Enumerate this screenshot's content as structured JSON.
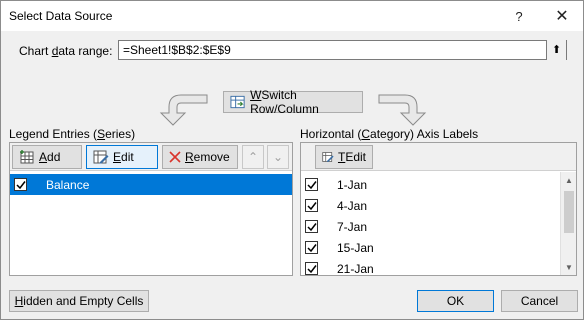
{
  "dialog": {
    "title": "Select Data Source",
    "help_glyph": "?",
    "close_glyph": "✕"
  },
  "range": {
    "label_prefix": "Chart ",
    "label_key": "d",
    "label_suffix": "ata range:",
    "value": "=Sheet1!$B$2:$E$9",
    "collapse_glyph": "⬆"
  },
  "switch": {
    "key": "W",
    "label_rest": "Switch Row/Column"
  },
  "legend": {
    "label_prefix": "Legend Entries (",
    "label_key": "S",
    "label_suffix": "eries)",
    "add_key": "A",
    "add_rest": "dd",
    "edit_label": "Edit",
    "edit_key": "E",
    "edit_rest": "dit",
    "remove_key": "R",
    "remove_rest": "emove",
    "move_up_glyph": "⌃",
    "move_down_glyph": "⌄",
    "items": [
      {
        "label": "Balance",
        "checked": true,
        "selected": true
      }
    ]
  },
  "axis": {
    "label_prefix": "Horizontal (",
    "label_key": "C",
    "label_suffix": "ategory) Axis Labels",
    "edit_key": "T",
    "edit_rest": "Edit",
    "items": [
      {
        "label": "1-Jan",
        "checked": true
      },
      {
        "label": "4-Jan",
        "checked": true
      },
      {
        "label": "7-Jan",
        "checked": true
      },
      {
        "label": "15-Jan",
        "checked": true
      },
      {
        "label": "21-Jan",
        "checked": true
      }
    ]
  },
  "buttons": {
    "hidden_key": "H",
    "hidden_rest": "idden and Empty Cells",
    "ok": "OK",
    "cancel": "Cancel"
  },
  "colors": {
    "accent": "#0078d7",
    "remove_icon": "#d9342b"
  }
}
